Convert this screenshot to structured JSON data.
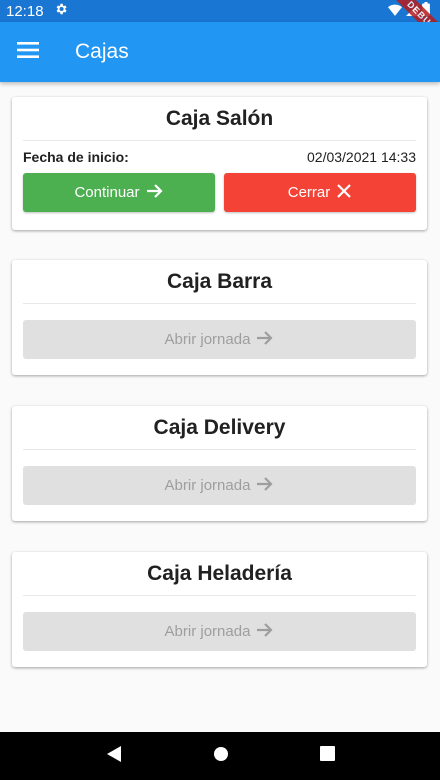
{
  "status_bar": {
    "time": "12:18",
    "debug_label": "DEBUG"
  },
  "app_bar": {
    "title": "Cajas"
  },
  "cards": [
    {
      "title": "Caja Salón",
      "start_label": "Fecha de inicio:",
      "start_value": "02/03/2021 14:33",
      "continue_label": "Continuar",
      "close_label": "Cerrar"
    },
    {
      "title": "Caja Barra",
      "open_label": "Abrir jornada"
    },
    {
      "title": "Caja Delivery",
      "open_label": "Abrir jornada"
    },
    {
      "title": "Caja Heladería",
      "open_label": "Abrir jornada"
    }
  ],
  "colors": {
    "app_bar": "#2196f3",
    "continue": "#4caf50",
    "close": "#f44336",
    "disabled": "#e0e0e0"
  }
}
